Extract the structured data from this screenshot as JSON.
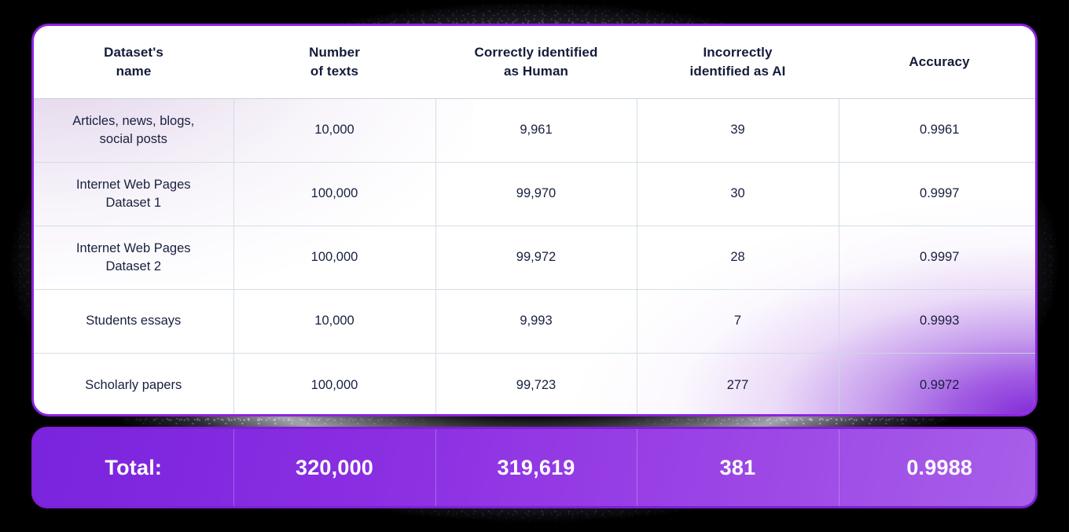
{
  "theme": {
    "background": "#000000",
    "card_background": "#ffffff",
    "border_purple": "#8b23e0",
    "total_bar_purple": "#8a2ee2",
    "header_text": "#141c3a",
    "cell_text": "#18203f",
    "total_text": "#ffffff"
  },
  "table": {
    "columns": [
      {
        "key": "dataset_name",
        "label_line1": "Dataset's",
        "label_line2": "name"
      },
      {
        "key": "number_of_texts",
        "label_line1": "Number",
        "label_line2": "of texts"
      },
      {
        "key": "correct_human",
        "label_line1": "Correctly identified",
        "label_line2": "as Human"
      },
      {
        "key": "incorrect_ai",
        "label_line1": "Incorrectly",
        "label_line2": "identified as AI"
      },
      {
        "key": "accuracy",
        "label_line1": "Accuracy",
        "label_line2": ""
      }
    ],
    "rows": [
      {
        "dataset_name_line1": "Articles, news, blogs,",
        "dataset_name_line2": "social posts",
        "number_of_texts": "10,000",
        "correct_human": "9,961",
        "incorrect_ai": "39",
        "accuracy": "0.9961"
      },
      {
        "dataset_name_line1": "Internet Web Pages",
        "dataset_name_line2": "Dataset 1",
        "number_of_texts": "100,000",
        "correct_human": "99,970",
        "incorrect_ai": "30",
        "accuracy": "0.9997"
      },
      {
        "dataset_name_line1": "Internet Web Pages",
        "dataset_name_line2": "Dataset 2",
        "number_of_texts": "100,000",
        "correct_human": "99,972",
        "incorrect_ai": "28",
        "accuracy": "0.9997"
      },
      {
        "dataset_name_line1": "Students essays",
        "dataset_name_line2": "",
        "number_of_texts": "10,000",
        "correct_human": "9,993",
        "incorrect_ai": "7",
        "accuracy": "0.9993"
      },
      {
        "dataset_name_line1": "Scholarly papers",
        "dataset_name_line2": "",
        "number_of_texts": "100,000",
        "correct_human": "99,723",
        "incorrect_ai": "277",
        "accuracy": "0.9972"
      }
    ],
    "total": {
      "label": "Total:",
      "number_of_texts": "320,000",
      "correct_human": "319,619",
      "incorrect_ai": "381",
      "accuracy": "0.9988"
    }
  },
  "chart_data": {
    "type": "table",
    "title": "",
    "columns": [
      "Dataset's name",
      "Number of texts",
      "Correctly identified as Human",
      "Incorrectly identified as AI",
      "Accuracy"
    ],
    "rows": [
      [
        "Articles, news, blogs, social posts",
        10000,
        9961,
        39,
        0.9961
      ],
      [
        "Internet Web Pages Dataset 1",
        100000,
        99970,
        30,
        0.9997
      ],
      [
        "Internet Web Pages Dataset 2",
        100000,
        99972,
        28,
        0.9997
      ],
      [
        "Students essays",
        10000,
        9993,
        7,
        0.9993
      ],
      [
        "Scholarly papers",
        100000,
        99723,
        277,
        0.9972
      ]
    ],
    "total_row": [
      "Total:",
      320000,
      319619,
      381,
      0.9988
    ]
  }
}
